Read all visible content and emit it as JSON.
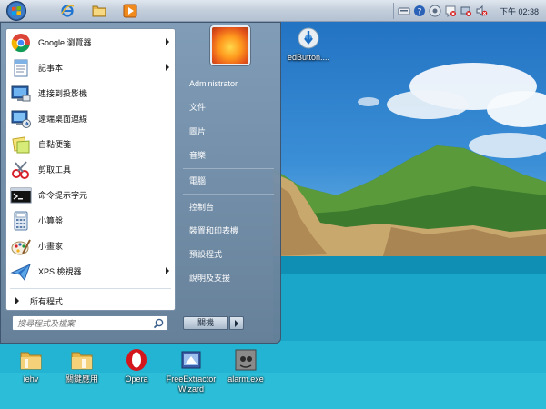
{
  "taskbar": {
    "clock": "下午 02:38"
  },
  "start_menu": {
    "pinned": [
      {
        "label": "Google 瀏覽器",
        "icon": "chrome-icon",
        "submenu": true
      },
      {
        "label": "記事本",
        "icon": "notepad-icon",
        "submenu": true
      },
      {
        "label": "連接到投影機",
        "icon": "projector-icon",
        "submenu": false
      },
      {
        "label": "遠端桌面連線",
        "icon": "remote-desktop-icon",
        "submenu": false
      },
      {
        "label": "自黏便箋",
        "icon": "sticky-notes-icon",
        "submenu": false
      },
      {
        "label": "剪取工具",
        "icon": "snipping-tool-icon",
        "submenu": false
      },
      {
        "label": "命令提示字元",
        "icon": "command-prompt-icon",
        "submenu": false
      },
      {
        "label": "小算盤",
        "icon": "calculator-icon",
        "submenu": false
      },
      {
        "label": "小畫家",
        "icon": "paint-icon",
        "submenu": false
      },
      {
        "label": "XPS 檢視器",
        "icon": "xps-viewer-icon",
        "submenu": true
      }
    ],
    "all_programs": "所有程式",
    "search_placeholder": "搜尋程式及檔案",
    "right": {
      "user": "Administrator",
      "documents": "文件",
      "pictures": "圖片",
      "music": "音樂",
      "computer": "電腦",
      "control_panel": "控制台",
      "devices_printers": "裝置和印表機",
      "default_programs": "預設程式",
      "help": "說明及支援"
    },
    "shutdown_label": "關機"
  },
  "desktop": {
    "top_icon_label": "edButton....",
    "icons": [
      {
        "label": "iehv",
        "icon": "folder-icon"
      },
      {
        "label": "關鍵應用",
        "icon": "folder-icon"
      },
      {
        "label": "Opera",
        "icon": "opera-icon"
      },
      {
        "label": "FreeExtractor Wizard",
        "icon": "installer-icon"
      },
      {
        "label": "alarm.exe",
        "icon": "alarm-icon"
      }
    ]
  }
}
